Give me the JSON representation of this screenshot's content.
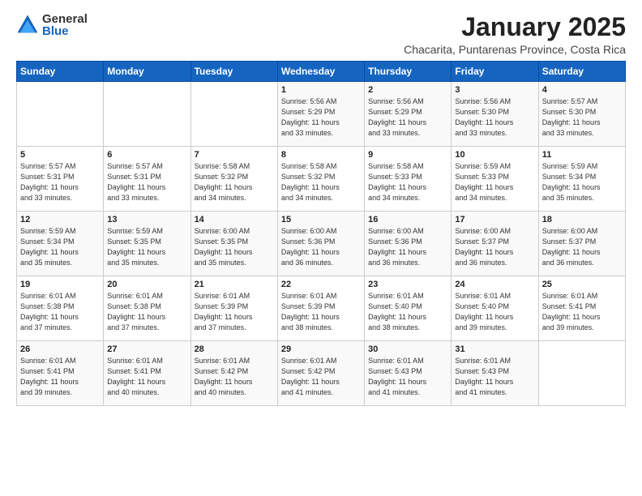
{
  "header": {
    "logo_general": "General",
    "logo_blue": "Blue",
    "title": "January 2025",
    "subtitle": "Chacarita, Puntarenas Province, Costa Rica"
  },
  "weekdays": [
    "Sunday",
    "Monday",
    "Tuesday",
    "Wednesday",
    "Thursday",
    "Friday",
    "Saturday"
  ],
  "weeks": [
    [
      {
        "day": "",
        "info": ""
      },
      {
        "day": "",
        "info": ""
      },
      {
        "day": "",
        "info": ""
      },
      {
        "day": "1",
        "info": "Sunrise: 5:56 AM\nSunset: 5:29 PM\nDaylight: 11 hours\nand 33 minutes."
      },
      {
        "day": "2",
        "info": "Sunrise: 5:56 AM\nSunset: 5:29 PM\nDaylight: 11 hours\nand 33 minutes."
      },
      {
        "day": "3",
        "info": "Sunrise: 5:56 AM\nSunset: 5:30 PM\nDaylight: 11 hours\nand 33 minutes."
      },
      {
        "day": "4",
        "info": "Sunrise: 5:57 AM\nSunset: 5:30 PM\nDaylight: 11 hours\nand 33 minutes."
      }
    ],
    [
      {
        "day": "5",
        "info": "Sunrise: 5:57 AM\nSunset: 5:31 PM\nDaylight: 11 hours\nand 33 minutes."
      },
      {
        "day": "6",
        "info": "Sunrise: 5:57 AM\nSunset: 5:31 PM\nDaylight: 11 hours\nand 33 minutes."
      },
      {
        "day": "7",
        "info": "Sunrise: 5:58 AM\nSunset: 5:32 PM\nDaylight: 11 hours\nand 34 minutes."
      },
      {
        "day": "8",
        "info": "Sunrise: 5:58 AM\nSunset: 5:32 PM\nDaylight: 11 hours\nand 34 minutes."
      },
      {
        "day": "9",
        "info": "Sunrise: 5:58 AM\nSunset: 5:33 PM\nDaylight: 11 hours\nand 34 minutes."
      },
      {
        "day": "10",
        "info": "Sunrise: 5:59 AM\nSunset: 5:33 PM\nDaylight: 11 hours\nand 34 minutes."
      },
      {
        "day": "11",
        "info": "Sunrise: 5:59 AM\nSunset: 5:34 PM\nDaylight: 11 hours\nand 35 minutes."
      }
    ],
    [
      {
        "day": "12",
        "info": "Sunrise: 5:59 AM\nSunset: 5:34 PM\nDaylight: 11 hours\nand 35 minutes."
      },
      {
        "day": "13",
        "info": "Sunrise: 5:59 AM\nSunset: 5:35 PM\nDaylight: 11 hours\nand 35 minutes."
      },
      {
        "day": "14",
        "info": "Sunrise: 6:00 AM\nSunset: 5:35 PM\nDaylight: 11 hours\nand 35 minutes."
      },
      {
        "day": "15",
        "info": "Sunrise: 6:00 AM\nSunset: 5:36 PM\nDaylight: 11 hours\nand 36 minutes."
      },
      {
        "day": "16",
        "info": "Sunrise: 6:00 AM\nSunset: 5:36 PM\nDaylight: 11 hours\nand 36 minutes."
      },
      {
        "day": "17",
        "info": "Sunrise: 6:00 AM\nSunset: 5:37 PM\nDaylight: 11 hours\nand 36 minutes."
      },
      {
        "day": "18",
        "info": "Sunrise: 6:00 AM\nSunset: 5:37 PM\nDaylight: 11 hours\nand 36 minutes."
      }
    ],
    [
      {
        "day": "19",
        "info": "Sunrise: 6:01 AM\nSunset: 5:38 PM\nDaylight: 11 hours\nand 37 minutes."
      },
      {
        "day": "20",
        "info": "Sunrise: 6:01 AM\nSunset: 5:38 PM\nDaylight: 11 hours\nand 37 minutes."
      },
      {
        "day": "21",
        "info": "Sunrise: 6:01 AM\nSunset: 5:39 PM\nDaylight: 11 hours\nand 37 minutes."
      },
      {
        "day": "22",
        "info": "Sunrise: 6:01 AM\nSunset: 5:39 PM\nDaylight: 11 hours\nand 38 minutes."
      },
      {
        "day": "23",
        "info": "Sunrise: 6:01 AM\nSunset: 5:40 PM\nDaylight: 11 hours\nand 38 minutes."
      },
      {
        "day": "24",
        "info": "Sunrise: 6:01 AM\nSunset: 5:40 PM\nDaylight: 11 hours\nand 39 minutes."
      },
      {
        "day": "25",
        "info": "Sunrise: 6:01 AM\nSunset: 5:41 PM\nDaylight: 11 hours\nand 39 minutes."
      }
    ],
    [
      {
        "day": "26",
        "info": "Sunrise: 6:01 AM\nSunset: 5:41 PM\nDaylight: 11 hours\nand 39 minutes."
      },
      {
        "day": "27",
        "info": "Sunrise: 6:01 AM\nSunset: 5:41 PM\nDaylight: 11 hours\nand 40 minutes."
      },
      {
        "day": "28",
        "info": "Sunrise: 6:01 AM\nSunset: 5:42 PM\nDaylight: 11 hours\nand 40 minutes."
      },
      {
        "day": "29",
        "info": "Sunrise: 6:01 AM\nSunset: 5:42 PM\nDaylight: 11 hours\nand 41 minutes."
      },
      {
        "day": "30",
        "info": "Sunrise: 6:01 AM\nSunset: 5:43 PM\nDaylight: 11 hours\nand 41 minutes."
      },
      {
        "day": "31",
        "info": "Sunrise: 6:01 AM\nSunset: 5:43 PM\nDaylight: 11 hours\nand 41 minutes."
      },
      {
        "day": "",
        "info": ""
      }
    ]
  ]
}
